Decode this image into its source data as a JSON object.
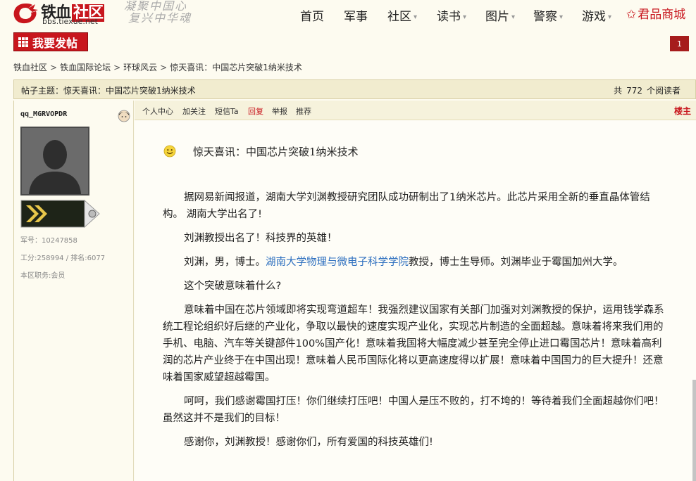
{
  "logo": {
    "name": "铁血",
    "name_red": "社区",
    "url": "bbs.tiexue.net",
    "slogan_line1": "凝聚中国心",
    "slogan_line2": "复兴中华魂"
  },
  "nav": {
    "items": [
      {
        "label": "首页"
      },
      {
        "label": "军事"
      },
      {
        "label": "社区"
      },
      {
        "label": "读书"
      },
      {
        "label": "图片"
      },
      {
        "label": "警察"
      },
      {
        "label": "游戏"
      }
    ],
    "mall_label": "君品商城"
  },
  "actions": {
    "post_button": "我要发帖",
    "page_number": "1"
  },
  "breadcrumb": [
    "铁血社区",
    "铁血国际论坛",
    "环球风云",
    "惊天喜讯：中国芯片突破1纳米技术"
  ],
  "thread": {
    "title_prefix": "帖子主题：",
    "title": "惊天喜讯：中国芯片突破1纳米技术",
    "readers_prefix": "共",
    "readers_count": "772",
    "readers_suffix": "个阅读者"
  },
  "author": {
    "username": "qq_MGRVOPDR",
    "military_id": "军号：10247858",
    "stats": "工分:258994 / 排名:6077",
    "role": "本区职务:会员"
  },
  "post_toolbar": {
    "items": [
      "个人中心",
      "加关注",
      "短信Ta",
      "回复",
      "举报",
      "推荐"
    ],
    "floor": "楼主"
  },
  "post": {
    "title": "惊天喜讯：中国芯片突破1纳米技术",
    "paragraphs": [
      {
        "text": "据网易新闻报道，湖南大学刘渊教授研究团队成功研制出了1纳米芯片。此芯片采用全新的垂直晶体管结构。 湖南大学出名了!"
      },
      {
        "text": "刘渊教授出名了！科技界的英雄！"
      },
      {
        "pre": "刘渊，男，博士。",
        "link": "湖南大学物理与微电子科学学院",
        "post": "教授，博士生导师。刘渊毕业于霉国加州大学。"
      },
      {
        "text": "这个突破意味着什么?"
      },
      {
        "text": "意味着中国在芯片领域即将实现弯道超车！我强烈建议国家有关部门加强对刘渊教授的保护，运用钱学森系统工程论组织好后继的产业化，争取以最快的速度实现产业化，实现芯片制造的全面超越。意味着将来我们用的手机、电脑、汽车等关键部件100%国产化！意味着我国将大幅度减少甚至完全停止进口霉国芯片！意味着高利润的芯片产业终于在中国出现！意味着人民币国际化将以更高速度得以扩展！意味着中国国力的巨大提升！还意味着国家威望超越霉国。"
      },
      {
        "text": "呵呵，我们感谢霉国打压！你们继续打压吧！中国人是压不败的，打不垮的！等待着我们全面超越你们吧！虽然这并不是我们的目标！"
      },
      {
        "text": "感谢你，刘渊教授！感谢你们，所有爱国的科技英雄们!"
      }
    ]
  },
  "colors": {
    "brand_red": "#c8161d",
    "link_blue": "#2d6fbf",
    "bar_beige": "#f1eccf"
  }
}
